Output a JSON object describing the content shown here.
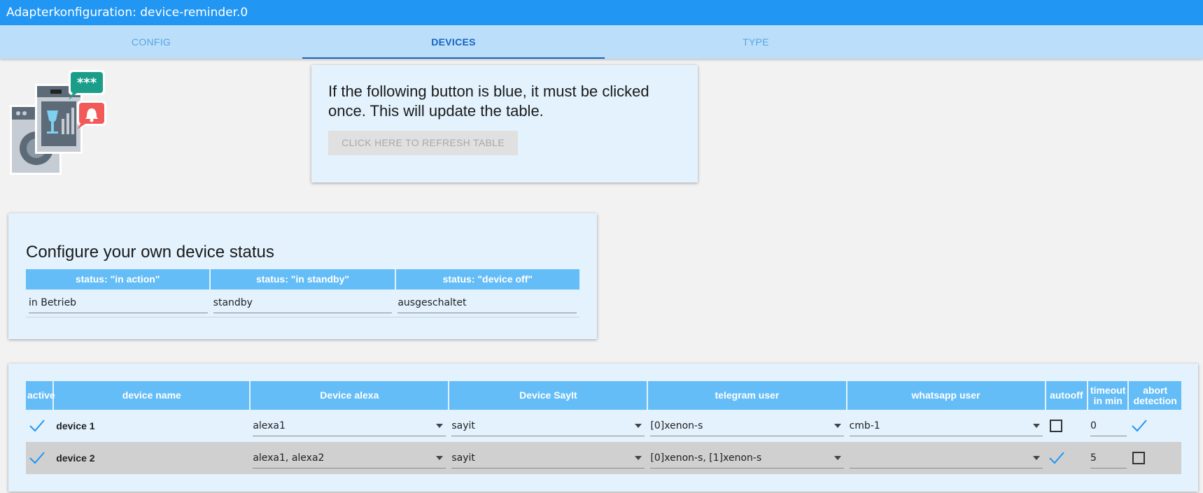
{
  "window": {
    "title": "Adapterkonfiguration: device-reminder.0"
  },
  "tabs": [
    {
      "label": "CONFIG",
      "active": false
    },
    {
      "label": "DEVICES",
      "active": true
    },
    {
      "label": "TYPE",
      "active": false
    }
  ],
  "refresh_card": {
    "text": "If the following button is blue, it must be clicked once. This will update the table.",
    "button_label": "CLICK HERE TO REFRESH TABLE"
  },
  "status_card": {
    "heading": "Configure your own device status",
    "columns": [
      "status: \"in action\"",
      "status: \"in standby\"",
      "status: \"device off\""
    ],
    "values": [
      "in Betrieb",
      "standby",
      "ausgeschaltet"
    ]
  },
  "devices_table": {
    "columns": {
      "active": "active",
      "device_name": "device name",
      "device_alexa": "Device alexa",
      "device_sayit": "Device SayIt",
      "telegram_user": "telegram user",
      "whatsapp_user": "whatsapp user",
      "autooff": "autooff",
      "timeout": "timeout in min",
      "abort_detection": "abort detection"
    },
    "rows": [
      {
        "active": true,
        "name": "device 1",
        "alexa": "alexa1",
        "sayit": "sayit",
        "telegram": "[0]xenon-s",
        "whatsapp": "cmb-1",
        "autooff": false,
        "timeout": "0",
        "abort_detection": true
      },
      {
        "active": true,
        "name": "device 2",
        "alexa": "alexa1, alexa2",
        "sayit": "sayit",
        "telegram": "[0]xenon-s, [1]xenon-s",
        "whatsapp": "",
        "autooff": true,
        "timeout": "5",
        "abort_detection": false
      }
    ]
  },
  "icons": {
    "logo": "device-reminder-logo-icon",
    "check": "checkmark-icon",
    "select_caret": "caret-down-icon"
  },
  "colors": {
    "title_bar": "#2196f3",
    "tab_bar": "#bbdefb",
    "tab_active": "#1565c0",
    "card_bg": "#e3f2fd",
    "table_header": "#64bdf6",
    "checkmark": "#2196f3"
  }
}
